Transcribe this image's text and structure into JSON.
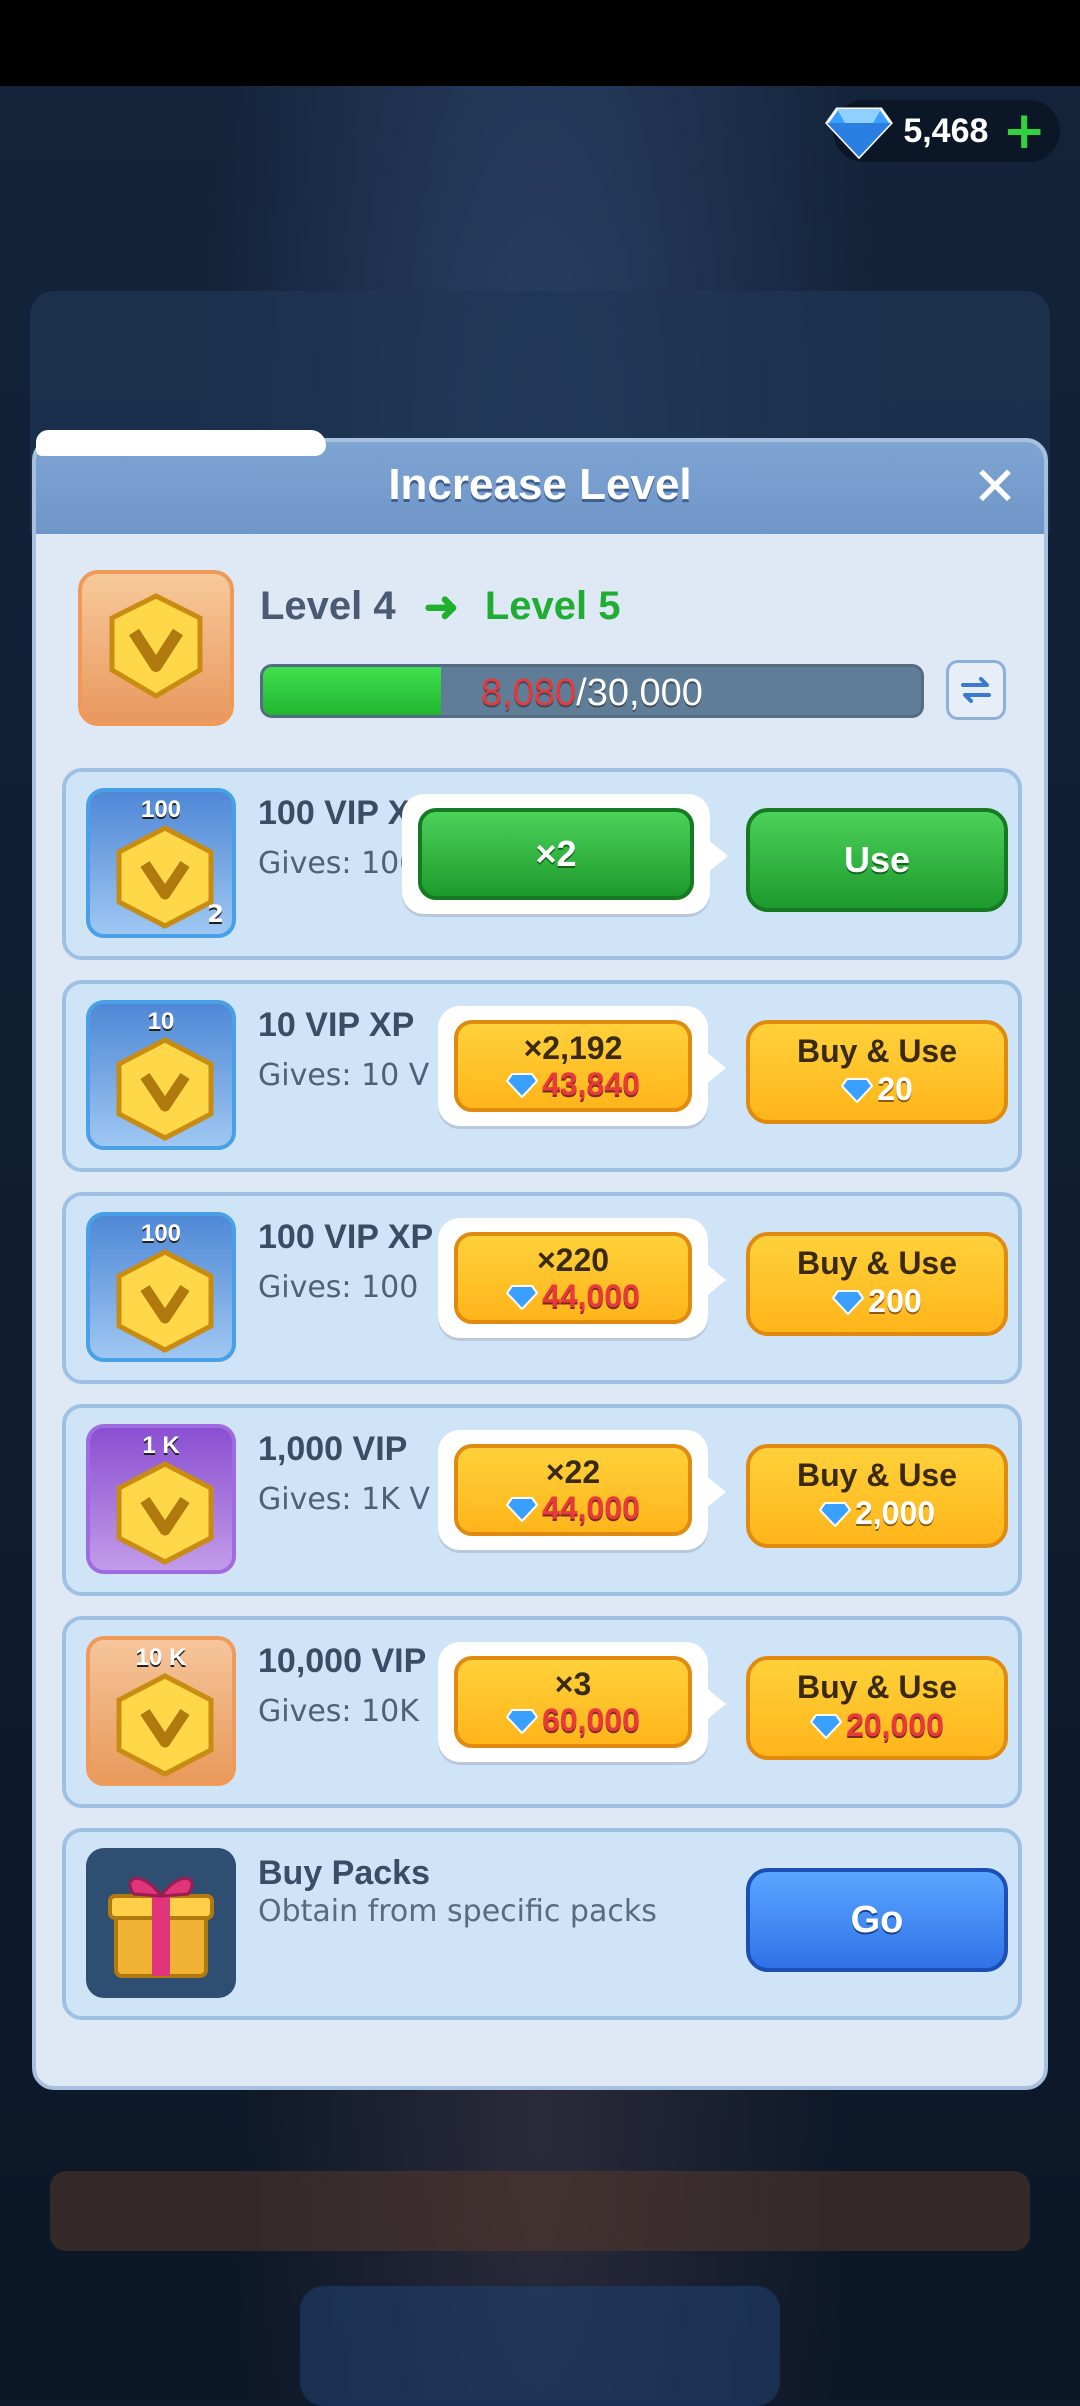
{
  "header": {
    "gems": "5,468",
    "plus": "+"
  },
  "dialog": {
    "title": "Increase Level",
    "close": "✕",
    "level_from": "Level 4",
    "level_to": "Level 5",
    "progress_current": "8,080",
    "progress_total": "/30,000",
    "progress_fraction": 0.27
  },
  "items": [
    {
      "badge": "100",
      "count": "2",
      "name": "100 VIP XP",
      "desc": "Gives: 100 V",
      "qty": "×2",
      "action": "Use",
      "thumb": "blue"
    },
    {
      "badge": "10",
      "name": "10 VIP XP",
      "desc": "Gives: 10 V",
      "qty": "×2,192",
      "qty_cost": "43,840",
      "action": "Buy & Use",
      "price": "20",
      "thumb": "blue"
    },
    {
      "badge": "100",
      "name": "100 VIP XP",
      "desc": "Gives: 100",
      "qty": "×220",
      "qty_cost": "44,000",
      "action": "Buy & Use",
      "price": "200",
      "thumb": "blue"
    },
    {
      "badge": "1 K",
      "name": "1,000 VIP",
      "desc": "Gives: 1K V",
      "qty": "×22",
      "qty_cost": "44,000",
      "action": "Buy & Use",
      "price": "2,000",
      "thumb": "purple"
    },
    {
      "badge": "10 K",
      "name": "10,000 VIP",
      "desc": "Gives: 10K",
      "qty": "×3",
      "qty_cost": "60,000",
      "action": "Buy & Use",
      "price": "20,000",
      "thumb": "orange"
    }
  ],
  "packs": {
    "name": "Buy Packs",
    "desc": "Obtain from specific packs",
    "action": "Go"
  },
  "colors": {
    "gem": "#3aa0ff",
    "accent_green": "#22b531",
    "accent_yellow": "#ffb51a",
    "accent_blue": "#2f72e8",
    "cost_red": "#e83a3a"
  }
}
